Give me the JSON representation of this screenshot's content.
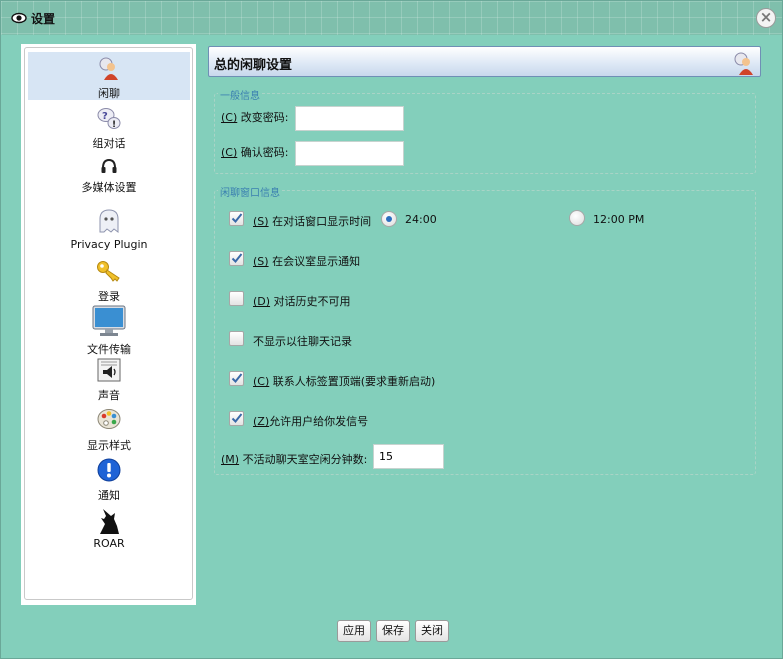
{
  "window": {
    "title": "设置",
    "close_label": "×"
  },
  "sidebar": {
    "items": [
      {
        "label": "闲聊",
        "icon": "chat-person-icon",
        "active": true
      },
      {
        "label": "组对话",
        "icon": "group-chat-icon"
      },
      {
        "label": "多媒体设置",
        "icon": "headset-icon"
      },
      {
        "label": "Privacy Plugin",
        "icon": "ghost-icon"
      },
      {
        "label": "登录",
        "icon": "key-icon"
      },
      {
        "label": "文件传输",
        "icon": "monitor-icon"
      },
      {
        "label": "声音",
        "icon": "sound-icon"
      },
      {
        "label": "显示样式",
        "icon": "palette-icon"
      },
      {
        "label": "通知",
        "icon": "info-icon"
      },
      {
        "label": "ROAR",
        "icon": "wolf-icon"
      }
    ]
  },
  "main": {
    "title": "总的闲聊设置",
    "general": {
      "legend": "一般信息",
      "change_password": {
        "mnemonic": "(C)",
        "label": " 改变密码:",
        "value": ""
      },
      "confirm_password": {
        "mnemonic": "(C)",
        "label": " 确认密码:",
        "value": ""
      }
    },
    "chat_window": {
      "legend": "闲聊窗口信息",
      "show_time": {
        "mnemonic": "(S)",
        "label": " 在对话窗口显示时间",
        "checked": true
      },
      "time_24": {
        "label": "24:00",
        "selected": true
      },
      "time_12": {
        "label": "12:00 PM",
        "selected": false
      },
      "room_notify": {
        "mnemonic": "(S)",
        "label": " 在会议室显示通知",
        "checked": true
      },
      "history_unavailable": {
        "mnemonic": "(D)",
        "label": " 对话历史不可用",
        "checked": false
      },
      "hide_history": {
        "mnemonic": "",
        "label": "不显示以往聊天记录",
        "checked": false
      },
      "contact_icon_top": {
        "mnemonic": "(C)",
        "label": " 联系人标签置顶端(要求重新启动)",
        "checked": true
      },
      "allow_buzz": {
        "mnemonic": "(Z)",
        "label": "允许用户给你发信号",
        "checked": true
      },
      "idle_minutes": {
        "mnemonic": "(M)",
        "label": " 不活动聊天室空闲分钟数:",
        "value": "15"
      }
    }
  },
  "footer": {
    "apply": "应用",
    "save": "保存",
    "close": "关闭"
  },
  "colors": {
    "background": "#83cfbb",
    "accent": "#2c6fbf",
    "legend": "#3a7fb0"
  }
}
